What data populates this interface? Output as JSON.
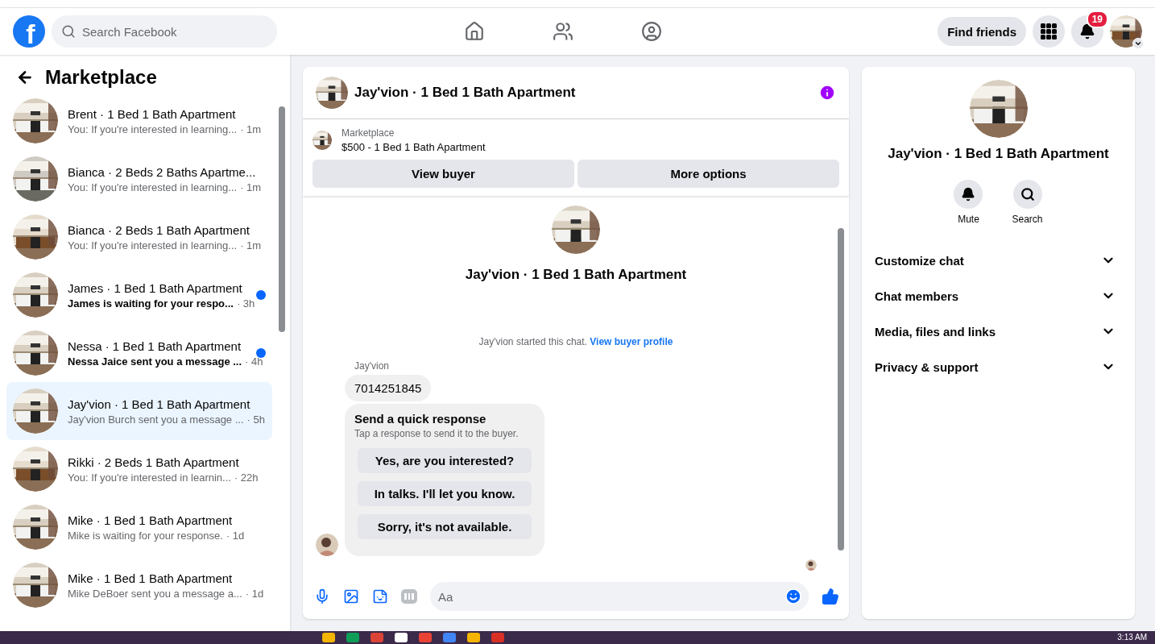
{
  "header": {
    "logo": "f",
    "search_placeholder": "Search Facebook",
    "find_friends": "Find friends",
    "notification_count": "19"
  },
  "sidebar": {
    "title": "Marketplace",
    "items": [
      {
        "title": "Brent · 1 Bed 1 Bath Apartment",
        "preview": "You: If you're interested in learning...",
        "time": "· 1m",
        "unread": false,
        "selected": false
      },
      {
        "title": "Bianca · 2 Beds 2 Baths Apartme...",
        "preview": "You: If you're interested in learning...",
        "time": "· 1m",
        "unread": false,
        "selected": false
      },
      {
        "title": "Bianca · 2 Beds 1 Bath Apartment",
        "preview": "You: If you're interested in learning...",
        "time": "· 1m",
        "unread": false,
        "selected": false
      },
      {
        "title": "James · 1 Bed 1 Bath Apartment",
        "preview": "James is waiting for your respo...",
        "time": "· 3h",
        "unread": true,
        "selected": false
      },
      {
        "title": "Nessa · 1 Bed 1 Bath Apartment",
        "preview": "Nessa Jaice sent you a message ...",
        "time": "· 4h",
        "unread": true,
        "selected": false
      },
      {
        "title": "Jay'vion · 1 Bed 1 Bath Apartment",
        "preview": "Jay'vion Burch sent you a message ...",
        "time": "· 5h",
        "unread": false,
        "selected": true
      },
      {
        "title": "Rikki · 2 Beds 1 Bath Apartment",
        "preview": "You: If you're interested in learnin...",
        "time": "· 22h",
        "unread": false,
        "selected": false
      },
      {
        "title": "Mike · 1 Bed 1 Bath Apartment",
        "preview": "Mike is waiting for your response.",
        "time": "· 1d",
        "unread": false,
        "selected": false
      },
      {
        "title": "Mike · 1 Bed 1 Bath Apartment",
        "preview": "Mike DeBoer sent you a message a...",
        "time": "· 1d",
        "unread": false,
        "selected": false
      }
    ]
  },
  "chat": {
    "title": "Jay'vion · 1 Bed 1 Bath Apartment",
    "listing": {
      "label": "Marketplace",
      "name": "$500 - 1 Bed 1 Bath Apartment"
    },
    "buttons": [
      "View buyer",
      "More options"
    ],
    "intro_title": "Jay'vion · 1 Bed 1 Bath Apartment",
    "started_text": "Jay'vion started this chat.",
    "profile_link": "View buyer profile",
    "sender": "Jay'vion",
    "message": "7014251845",
    "quick": {
      "title": "Send a quick response",
      "subtitle": "Tap a response to send it to the buyer.",
      "responses": [
        "Yes, are you interested?",
        "In talks. I'll let you know.",
        "Sorry, it's not available."
      ]
    },
    "composer_placeholder": "Aa"
  },
  "details": {
    "title": "Jay'vion · 1 Bed 1 Bath Apartment",
    "actions": [
      {
        "label": "Mute",
        "kind": "bell"
      },
      {
        "label": "Search",
        "kind": "search"
      }
    ],
    "sections": [
      "Customize chat",
      "Chat members",
      "Media, files and links",
      "Privacy & support"
    ]
  },
  "taskbar": {
    "clock": "3:13 AM"
  }
}
